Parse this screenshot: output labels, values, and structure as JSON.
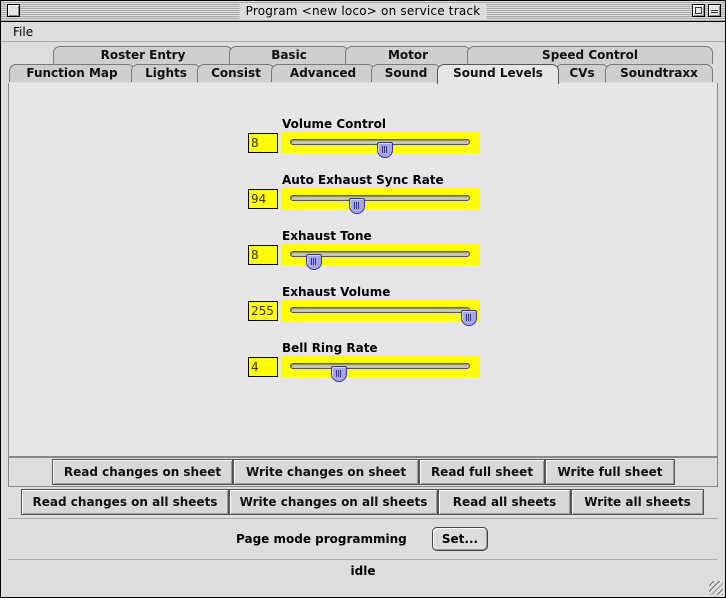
{
  "window": {
    "title": "Program <new loco> on service track"
  },
  "menu": {
    "file_label": "File"
  },
  "tabs": {
    "row1": [
      "Roster Entry",
      "Basic",
      "Motor",
      "Speed Control"
    ],
    "row2": [
      "Function Map",
      "Lights",
      "Consist",
      "Advanced",
      "Sound",
      "Sound Levels",
      "CVs",
      "Soundtraxx"
    ],
    "selected": "Sound Levels"
  },
  "sliders": [
    {
      "label": "Volume Control",
      "value": "8",
      "level": 0.53
    },
    {
      "label": "Auto Exhaust Sync Rate",
      "value": "94",
      "level": 0.37
    },
    {
      "label": "Exhaust Tone",
      "value": "8",
      "level": 0.13
    },
    {
      "label": "Exhaust Volume",
      "value": "255",
      "level": 1.0
    },
    {
      "label": "Bell Ring Rate",
      "value": "4",
      "level": 0.27
    }
  ],
  "sheet_buttons": {
    "read_changes": "Read changes on sheet",
    "write_changes": "Write changes on sheet",
    "read_full": "Read full sheet",
    "write_full": "Write full sheet"
  },
  "all_buttons": {
    "read_changes_all": "Read changes on all sheets",
    "write_changes_all": "Write changes on all sheets",
    "read_all": "Read all sheets",
    "write_all": "Write all sheets"
  },
  "mode": {
    "label": "Page mode programming",
    "set_button": "Set..."
  },
  "status": {
    "text": "idle"
  },
  "colors": {
    "value_field": "#ffff00",
    "thumb": "#a6a6e6"
  }
}
